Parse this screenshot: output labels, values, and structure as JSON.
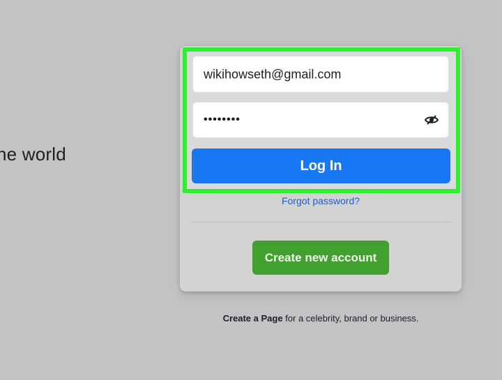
{
  "tagline": {
    "text": "he world"
  },
  "login_form": {
    "email_value": "wikihowseth@gmail.com",
    "password_value": "••••••••",
    "show_password_icon": "eye-icon",
    "login_label": "Log In",
    "forgot_password_label": "Forgot password?",
    "create_account_label": "Create new account",
    "highlight_color": "#2ef02e",
    "login_color": "#1877f2",
    "create_color": "#42a02f"
  },
  "page_promo": {
    "link_text": "Create a Page",
    "rest_text": " for a celebrity, brand or business."
  }
}
